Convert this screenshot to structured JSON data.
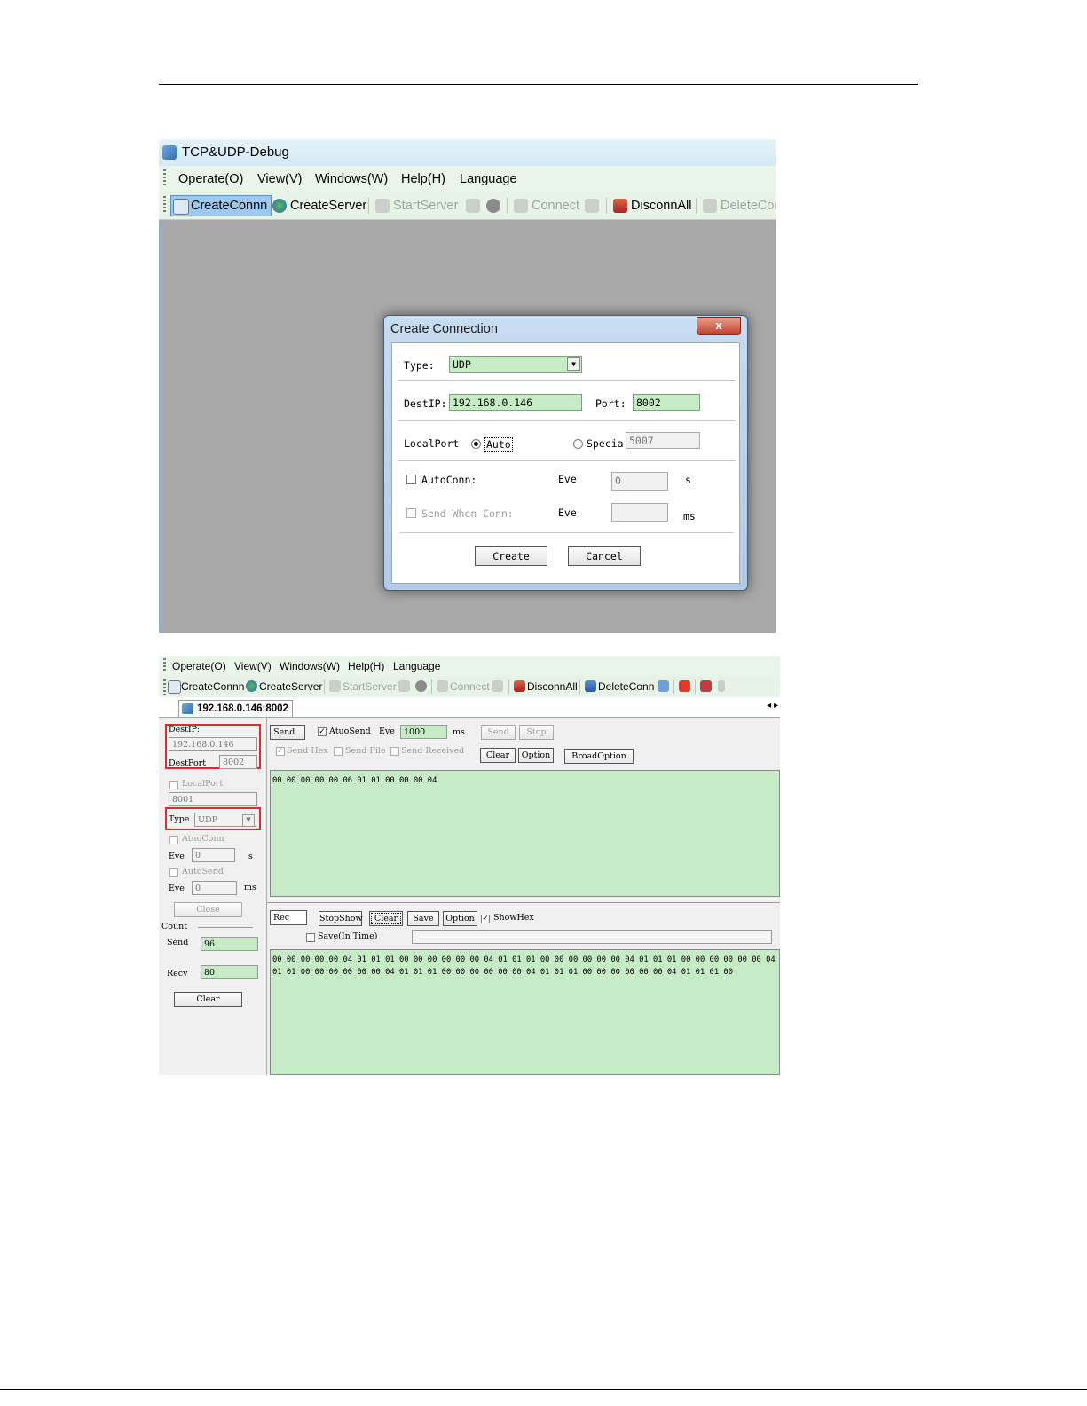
{
  "app": {
    "title": "TCP&UDP-Debug"
  },
  "menu": [
    "Operate(O)",
    "View(V)",
    "Windows(W)",
    "Help(H)",
    "Language"
  ],
  "toolbar1": {
    "create_conn": "CreateConnn",
    "create_server": "CreateServer",
    "start_server": "StartServer",
    "connect": "Connect",
    "disconn_all": "DisconnAll",
    "delete_conn": "DeleteCon"
  },
  "dialog": {
    "title": "Create Connection",
    "close": "x",
    "type_label": "Type:",
    "type_value": "UDP",
    "destip_label": "DestIP:",
    "destip_value": "192.168.0.146",
    "port_label": "Port:",
    "port_value": "8002",
    "localport_label": "LocalPort",
    "auto_label": "Auto",
    "special_label": "Specia",
    "special_value": "5007",
    "autoconn_label": "AutoConn:",
    "eve_label": "Eve",
    "eve_value": "0",
    "s_unit": "s",
    "send_when_conn_label": "Send When Conn:",
    "eve2_label": "Eve",
    "eve2_value": "",
    "ms_unit": "ms",
    "create_button": "Create",
    "cancel_button": "Cancel"
  },
  "toolbar2": {
    "create_conn": "CreateConnn",
    "create_server": "CreateServer",
    "start_server": "StartServer",
    "connect": "Connect",
    "disconn_all": "DisconnAll",
    "delete_conn": "DeleteConn"
  },
  "tab": {
    "label": "192.168.0.146:8002",
    "nav": "◂ ▸"
  },
  "left_panel": {
    "destip_label": "DestIP:",
    "destip_value": "192.168.0.146",
    "destport_label": "DestPort",
    "destport_value": "8002",
    "localport_label": "LocalPort",
    "localport_value": "8001",
    "type_label": "Type",
    "type_value": "UDP",
    "autoconn_label": "AtuoConn",
    "eve_label": "Eve",
    "eve_value": "0",
    "s_unit": "s",
    "autosend_label": "AutoSend",
    "eve2_label": "Eve",
    "eve2_value": "0",
    "ms_unit": "ms",
    "close_button": "Close",
    "count_label": "Count",
    "send_label": "Send",
    "send_count": "96",
    "recv_label": "Recv",
    "recv_count": "80",
    "clear_button": "Clear"
  },
  "send_panel": {
    "send_label": "Send",
    "autosend_label": "AtuoSend",
    "eve_label": "Eve",
    "eve_value": "1000",
    "ms_unit": "ms",
    "send_button": "Send",
    "stop_button": "Stop",
    "send_hex_label": "Send Hex",
    "send_file_label": "Send File",
    "send_received_label": "Send Received",
    "clear_button": "Clear",
    "option_button": "Option",
    "broad_option_button": "BroadOption",
    "data": "00 00 00 00 00 06 01 01 00 00 00 04"
  },
  "recv_panel": {
    "rec_label": "Rec",
    "stopshow_button": "StopShow",
    "clear_button": "Clear",
    "save_button": "Save",
    "option_button": "Option",
    "showhex_label": "ShowHex",
    "save_in_time_label": "Save(In Time)",
    "line1": "00 00 00 00 00 04 01 01 01 00 00 00 00 00 00 04 01 01 01 00 00 00 00 00 00 04 01 01 01 00 00 00 00 00 00 04 01",
    "line2": "01 01 00 00 00 00 00 00 04 01 01 01 00 00 00 00 00 00 04 01 01 01 00 00 00 00 00 00 04 01 01 01 00"
  },
  "colors": {
    "field_green": "#c6ecc6",
    "highlight_red": "#e02b2b",
    "toolbar_green": "#e6f3e6"
  }
}
